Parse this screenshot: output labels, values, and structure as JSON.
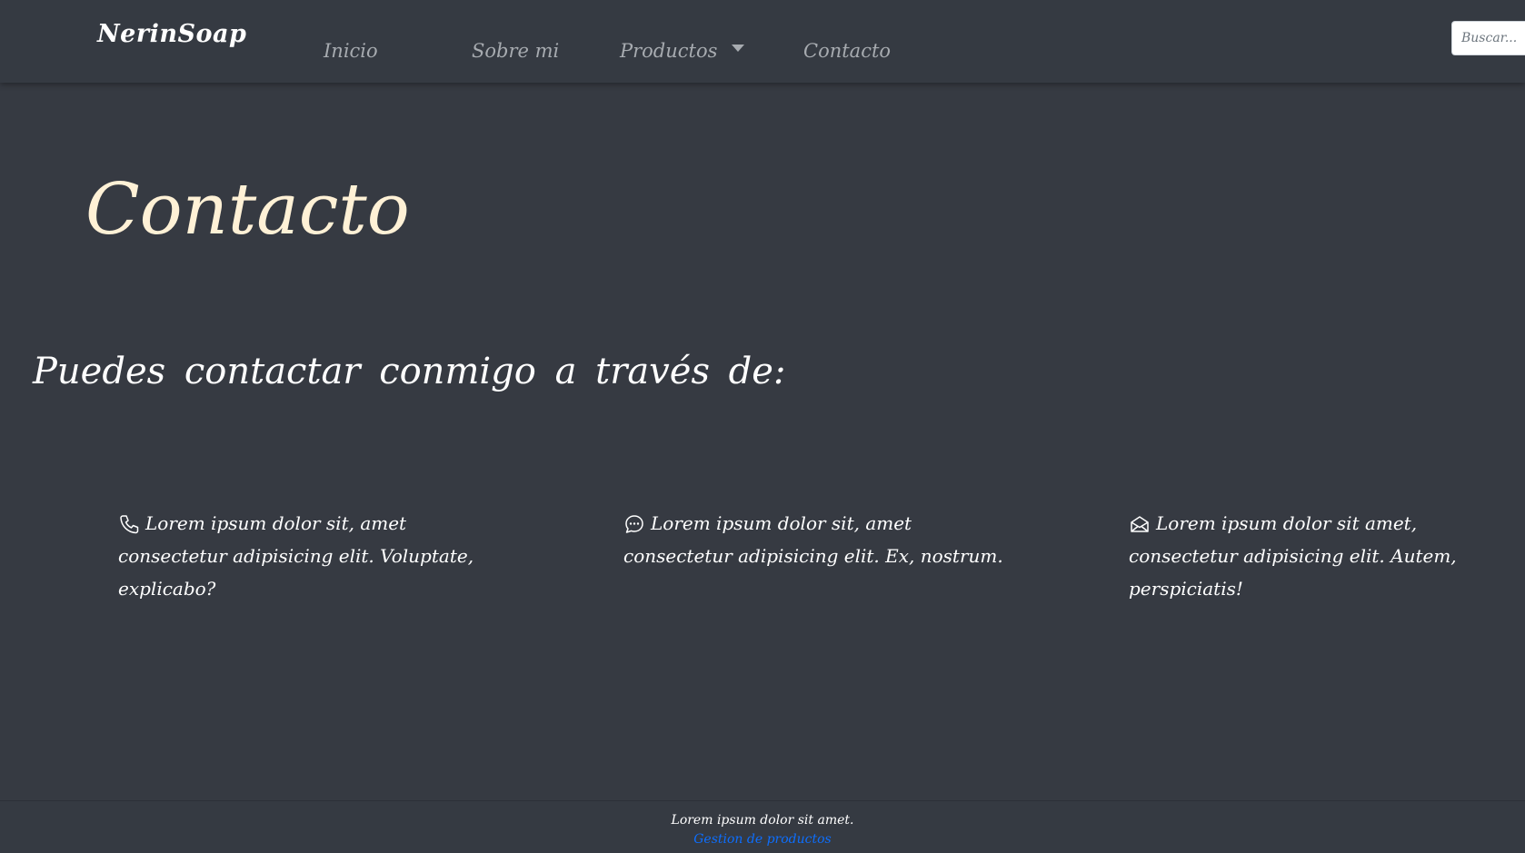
{
  "navbar": {
    "brand": "NerinSoap",
    "links": [
      {
        "label": "Inicio"
      },
      {
        "label": "Sobre mi"
      },
      {
        "label": "Productos"
      },
      {
        "label": "Contacto"
      }
    ],
    "search_placeholder": "Buscar..."
  },
  "main": {
    "title": "Contacto",
    "subtitle": "Puedes contactar conmigo a través de:",
    "items": [
      {
        "icon": "phone-icon",
        "text": "Lorem ipsum dolor sit, amet consectetur adipisicing elit. Voluptate, explicabo?"
      },
      {
        "icon": "chat-icon",
        "text": "Lorem ipsum dolor sit, amet consectetur adipisicing elit. Ex, nostrum."
      },
      {
        "icon": "envelope-icon",
        "text": "Lorem ipsum dolor sit amet, consectetur adipisicing elit. Autem, perspiciatis!"
      }
    ]
  },
  "footer": {
    "text": "Lorem ipsum dolor sit amet.",
    "link": "Gestion de productos"
  },
  "colors": {
    "background": "#363a42",
    "title": "#fff1d6",
    "nav_link": "#a7abb0",
    "footer_link": "#0d6efd"
  }
}
